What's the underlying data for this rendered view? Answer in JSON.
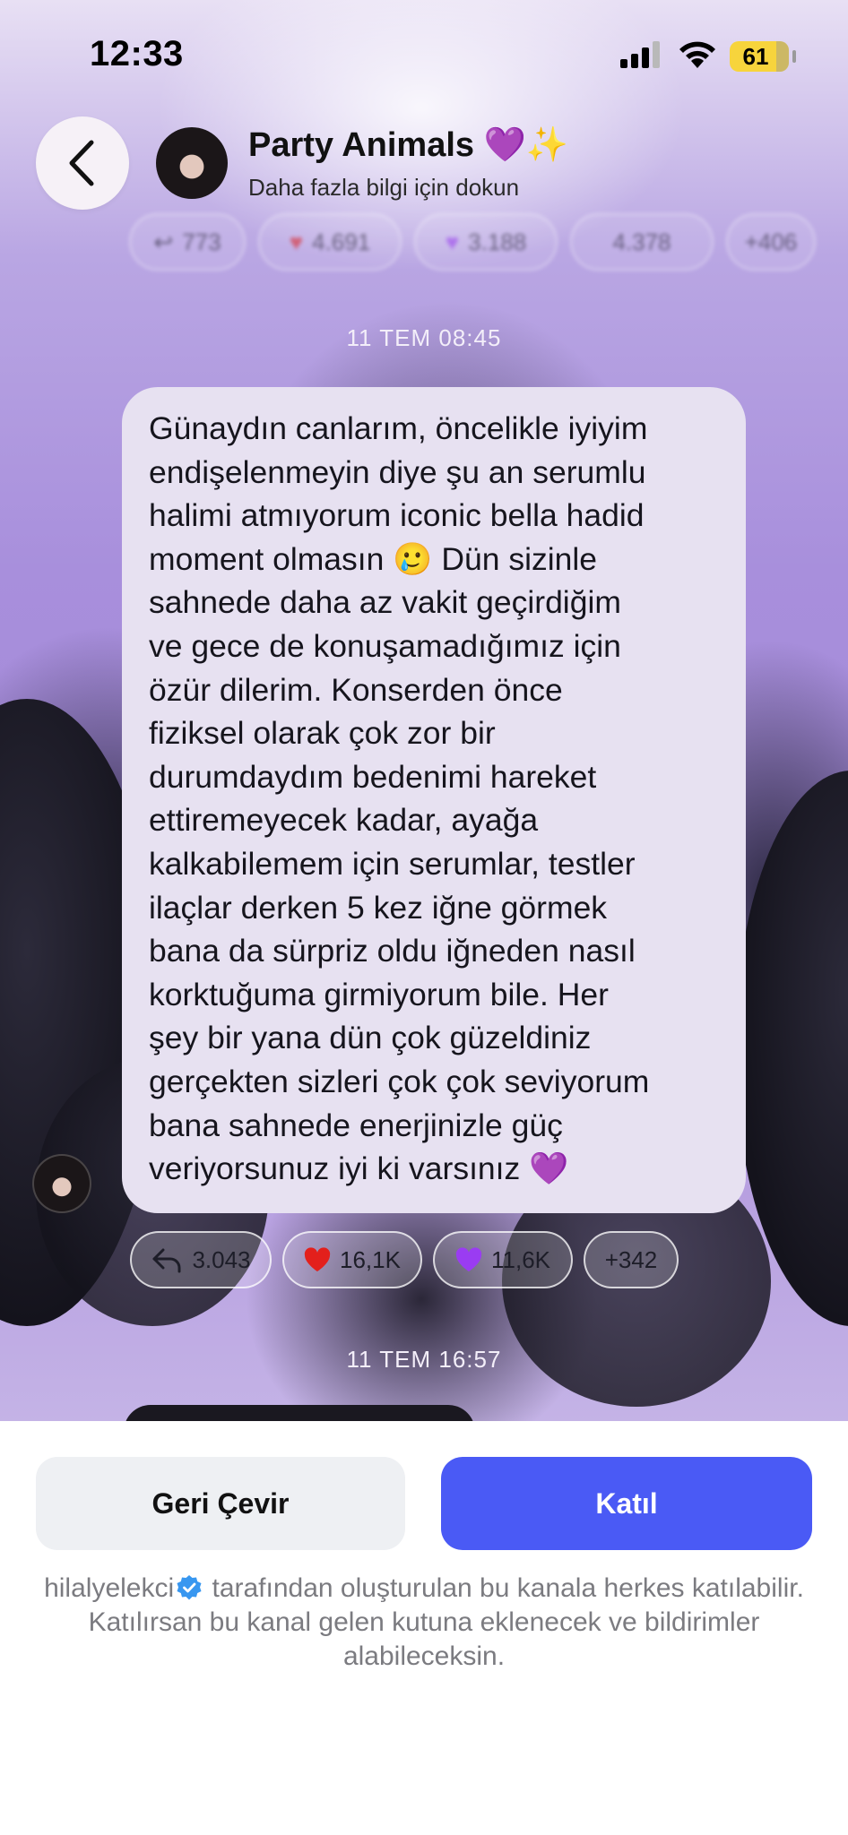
{
  "status_bar": {
    "time": "12:33",
    "battery": "61"
  },
  "header": {
    "title": "Party Animals",
    "title_emojis": "💜✨",
    "subtitle": "Daha fazla bilgi için dokun"
  },
  "top_reactions": [
    "773",
    "4.691",
    "3.188",
    "4.378",
    "+406"
  ],
  "messages": [
    {
      "timestamp": "11 TEM 08:45",
      "text": "Günaydın canlarım, öncelikle iyiyim\nendişelenmeyin diye şu an serumlu\nhalimi atmıyorum iconic bella hadid\nmoment olmasın 🥲 Dün sizinle\nsahnede daha az vakit geçirdiğim\nve gece de konuşamadığımız için\nözür dilerim. Konserden önce\nfiziksel olarak çok zor bir\ndurumdaydım bedenimi hareket\nettiremeyecek kadar, ayağa\nkalkabilemem için serumlar, testler\nilaçlar derken 5 kez iğne görmek\nbana da sürpriz oldu iğneden nasıl\nkorktuğuma girmiyorum bile. Her\nşey bir yana dün çok güzeldiniz\ngerçekten sizleri çok çok seviyorum\nbana sahnede enerjinizle güç\nveriyorsunuz iyi ki varsınız 💜",
      "reactions": {
        "replies": "3.043",
        "hearts": "16,1K",
        "purple_hearts": "11,6K",
        "more": "+342"
      }
    },
    {
      "timestamp": "11 TEM 16:57"
    }
  ],
  "bottom_sheet": {
    "decline_label": "Geri Çevir",
    "join_label": "Katıl",
    "creator": "hilalyelekci",
    "info_text": " tarafından oluşturulan bu kanala herkes katılabilir. Katılırsan bu kanal gelen kutuna eklenecek ve bildirimler alabileceksin."
  },
  "colors": {
    "join_button": "#4a5af5",
    "decline_button": "#eef0f3",
    "bubble": "#e7e1f1",
    "battery": "#f7d43c",
    "verified_badge": "#3897f0"
  },
  "icons": [
    "back-chevron-icon",
    "signal-icon",
    "wifi-icon",
    "battery-icon",
    "reply-icon",
    "heart-icon",
    "purple-heart-icon",
    "verified-badge-icon"
  ]
}
